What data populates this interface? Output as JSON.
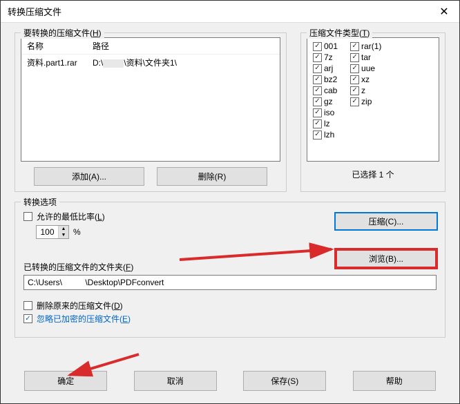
{
  "title": "转换压缩文件",
  "archives_fieldset": {
    "label_pre": "要转换的压缩文件(",
    "label_hot": "H",
    "label_post": ")",
    "col_name": "名称",
    "col_path": "路径",
    "row_name": "资料.part1.rar",
    "row_path_pre": "D:\\",
    "row_path_post": "\\资料\\文件夹1\\",
    "add_btn": "添加(A)...",
    "del_btn": "删除(R)"
  },
  "types_fieldset": {
    "label_pre": "压缩文件类型(",
    "label_hot": "T",
    "label_post": ")",
    "col_left": [
      "001",
      "7z",
      "arj",
      "bz2",
      "cab",
      "gz",
      "iso",
      "lz",
      "lzh"
    ],
    "col_right": [
      "rar(1)",
      "tar",
      "uue",
      "xz",
      "z",
      "zip"
    ],
    "selected_text": "已选择 1 个"
  },
  "options_fieldset": {
    "label": "转换选项",
    "allow_ratio_pre": "允许的最低比率(",
    "allow_ratio_hot": "L",
    "allow_ratio_post": ")",
    "ratio_value": "100",
    "ratio_suffix": "%",
    "compress_btn": "压缩(C)...",
    "folder_label_pre": "已转换的压缩文件的文件夹(",
    "folder_label_hot": "F",
    "folder_label_post": ")",
    "folder_value": "C:\\Users\\          \\Desktop\\PDFconvert",
    "browse_btn": "浏览(B)...",
    "delete_orig_pre": "删除原来的压缩文件(",
    "delete_orig_hot": "D",
    "delete_orig_post": ")",
    "ignore_enc_pre": "忽略已加密的压缩文件(",
    "ignore_enc_hot": "E",
    "ignore_enc_post": ")"
  },
  "buttons": {
    "ok": "确定",
    "cancel": "取消",
    "save": "保存(S)",
    "help": "帮助"
  }
}
